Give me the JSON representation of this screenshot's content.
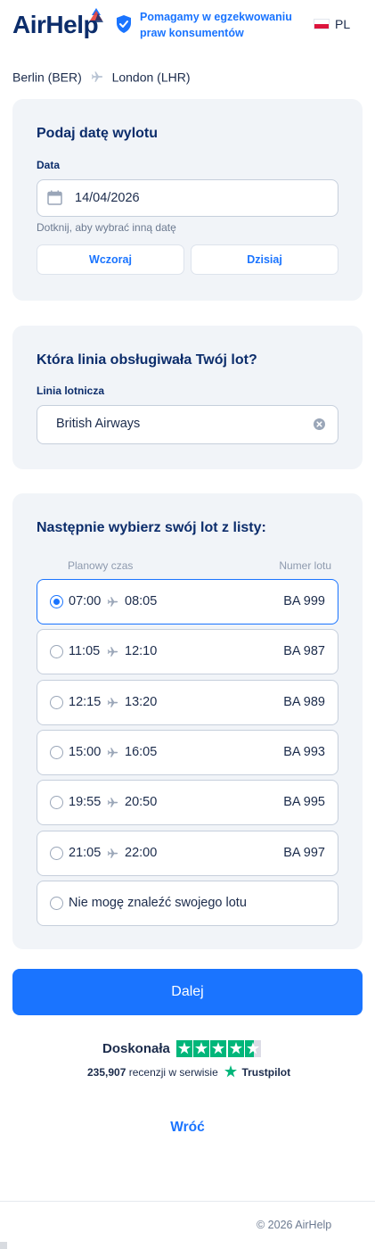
{
  "header": {
    "logo": "AirHelp",
    "tagline": "Pomagamy w egzekwowaniu praw konsumentów",
    "language": "PL"
  },
  "route": {
    "from": "Berlin (BER)",
    "to": "London (LHR)"
  },
  "date_card": {
    "title": "Podaj datę wylotu",
    "label": "Data",
    "value": "14/04/2026",
    "hint": "Dotknij, aby wybrać inną datę",
    "yesterday": "Wczoraj",
    "today": "Dzisiaj"
  },
  "airline_card": {
    "title": "Która linia obsługiwała Twój lot?",
    "label": "Linia lotnicza",
    "value": "British Airways"
  },
  "flights_card": {
    "title": "Następnie wybierz swój lot z listy:",
    "col_time": "Planowy czas",
    "col_number": "Numer lotu",
    "flights": [
      {
        "dep": "07:00",
        "arr": "08:05",
        "num": "BA 999",
        "selected": true
      },
      {
        "dep": "11:05",
        "arr": "12:10",
        "num": "BA 987",
        "selected": false
      },
      {
        "dep": "12:15",
        "arr": "13:20",
        "num": "BA 989",
        "selected": false
      },
      {
        "dep": "15:00",
        "arr": "16:05",
        "num": "BA 993",
        "selected": false
      },
      {
        "dep": "19:55",
        "arr": "20:50",
        "num": "BA 995",
        "selected": false
      },
      {
        "dep": "21:05",
        "arr": "22:00",
        "num": "BA 997",
        "selected": false
      }
    ],
    "not_found": "Nie mogę znaleźć swojego lotu"
  },
  "next_button": "Dalej",
  "trustpilot": {
    "rating_label": "Doskonała",
    "stars": 4.5,
    "review_count": "235,907",
    "reviews_text": "recenzji w serwisie",
    "brand": "Trustpilot"
  },
  "back_link": "Wróć",
  "footer": {
    "copyright": "© 2026 AirHelp"
  },
  "colors": {
    "brand_blue": "#1a74ff",
    "navy": "#0c2d6b",
    "trustpilot_green": "#00b67a",
    "card_bg": "#f1f4f8"
  }
}
